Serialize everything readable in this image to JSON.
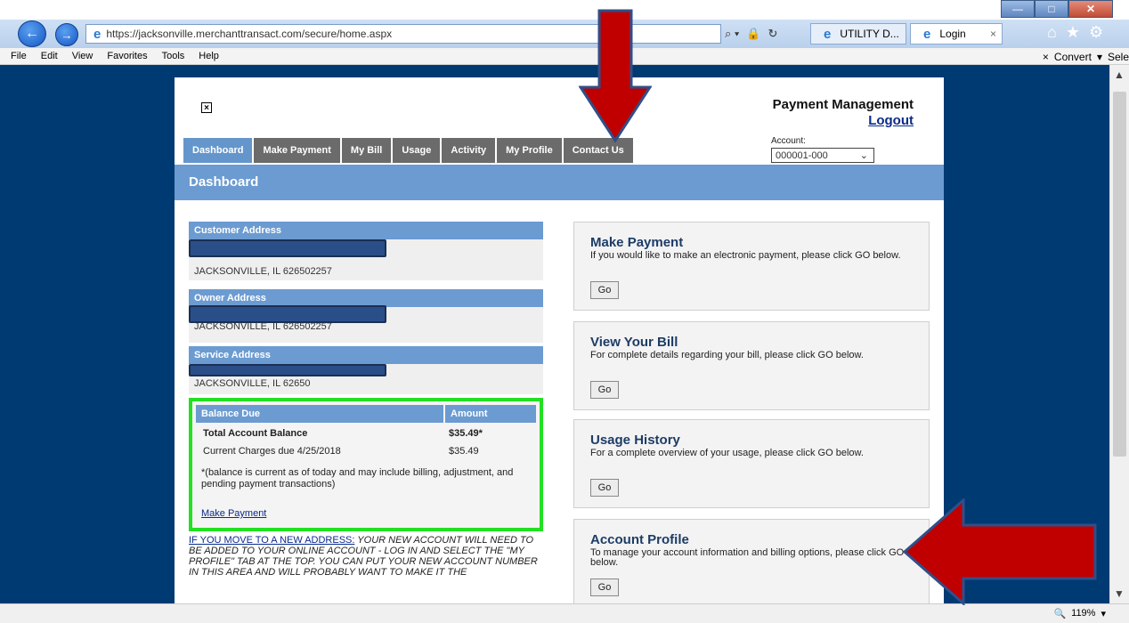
{
  "window": {
    "min_label": "—",
    "max_label": "□",
    "close_label": "✕"
  },
  "browser": {
    "back_symbol": "←",
    "forward_symbol": "→",
    "url": "https://jacksonville.merchanttransact.com/secure/home.aspx",
    "search_symbol": "⌕ ▾",
    "lock_symbol": "🔒",
    "refresh_symbol": "↻",
    "tabs": [
      {
        "label": "UTILITY D...",
        "active": false
      },
      {
        "label": "Login",
        "active": true
      }
    ],
    "tab_close": "×",
    "home_symbol": "⌂",
    "fav_symbol": "★",
    "settings_symbol": "⚙"
  },
  "menu": {
    "items": [
      "File",
      "Edit",
      "View",
      "Favorites",
      "Tools",
      "Help"
    ],
    "close_symbol": "×",
    "convert_label": "Convert",
    "select_label": "Sele"
  },
  "status": {
    "zoom_label": "119%"
  },
  "page": {
    "close_glyph": "×",
    "title": "Payment Management",
    "logout": "Logout",
    "tabs": [
      "Dashboard",
      "Make Payment",
      "My Bill",
      "Usage",
      "Activity",
      "My Profile",
      "Contact Us"
    ],
    "active_tab": "Dashboard",
    "account_label": "Account:",
    "account_value": "000001-000",
    "dashboard_title": "Dashboard"
  },
  "addresses": [
    {
      "heading": "Customer Address",
      "city": "JACKSONVILLE, IL 626502257"
    },
    {
      "heading": "Owner Address",
      "city": "JACKSONVILLE, IL 626502257"
    },
    {
      "heading": "Service Address",
      "city": "JACKSONVILLE, IL 62650"
    }
  ],
  "balance": {
    "col_due": "Balance Due",
    "col_amount": "Amount",
    "total_label": "Total Account Balance",
    "total_amount": "$35.49*",
    "current_label": "Current Charges due 4/25/2018",
    "current_amount": "$35.49",
    "note": "*(balance is current as of today and may include billing, adjustment, and pending payment transactions)",
    "link": "Make Payment"
  },
  "move_notice": {
    "link_text": "IF YOU MOVE TO A NEW ADDRESS:",
    "text": " YOUR NEW ACCOUNT WILL NEED TO BE ADDED TO YOUR ONLINE ACCOUNT - LOG IN AND SELECT THE \"MY PROFILE\" TAB AT THE TOP.  YOU CAN PUT YOUR NEW ACCOUNT NUMBER IN THIS AREA AND WILL PROBABLY WANT TO MAKE IT THE"
  },
  "cards": [
    {
      "title": "Make Payment",
      "text": "If you would like to make an electronic payment, please click GO below.",
      "button": "Go"
    },
    {
      "title": "View Your Bill",
      "text": "For complete details regarding your bill, please click GO below.",
      "button": "Go"
    },
    {
      "title": "Usage History",
      "text": "For a complete overview of your usage, please click GO below.",
      "button": "Go"
    },
    {
      "title": "Account Profile",
      "text": "To manage your account information and billing options, please click GO below.",
      "button": "Go"
    }
  ],
  "colors": {
    "annotation_red": "#c00000",
    "annotation_outline": "#2f4f8a",
    "highlight_green": "#22e022"
  }
}
